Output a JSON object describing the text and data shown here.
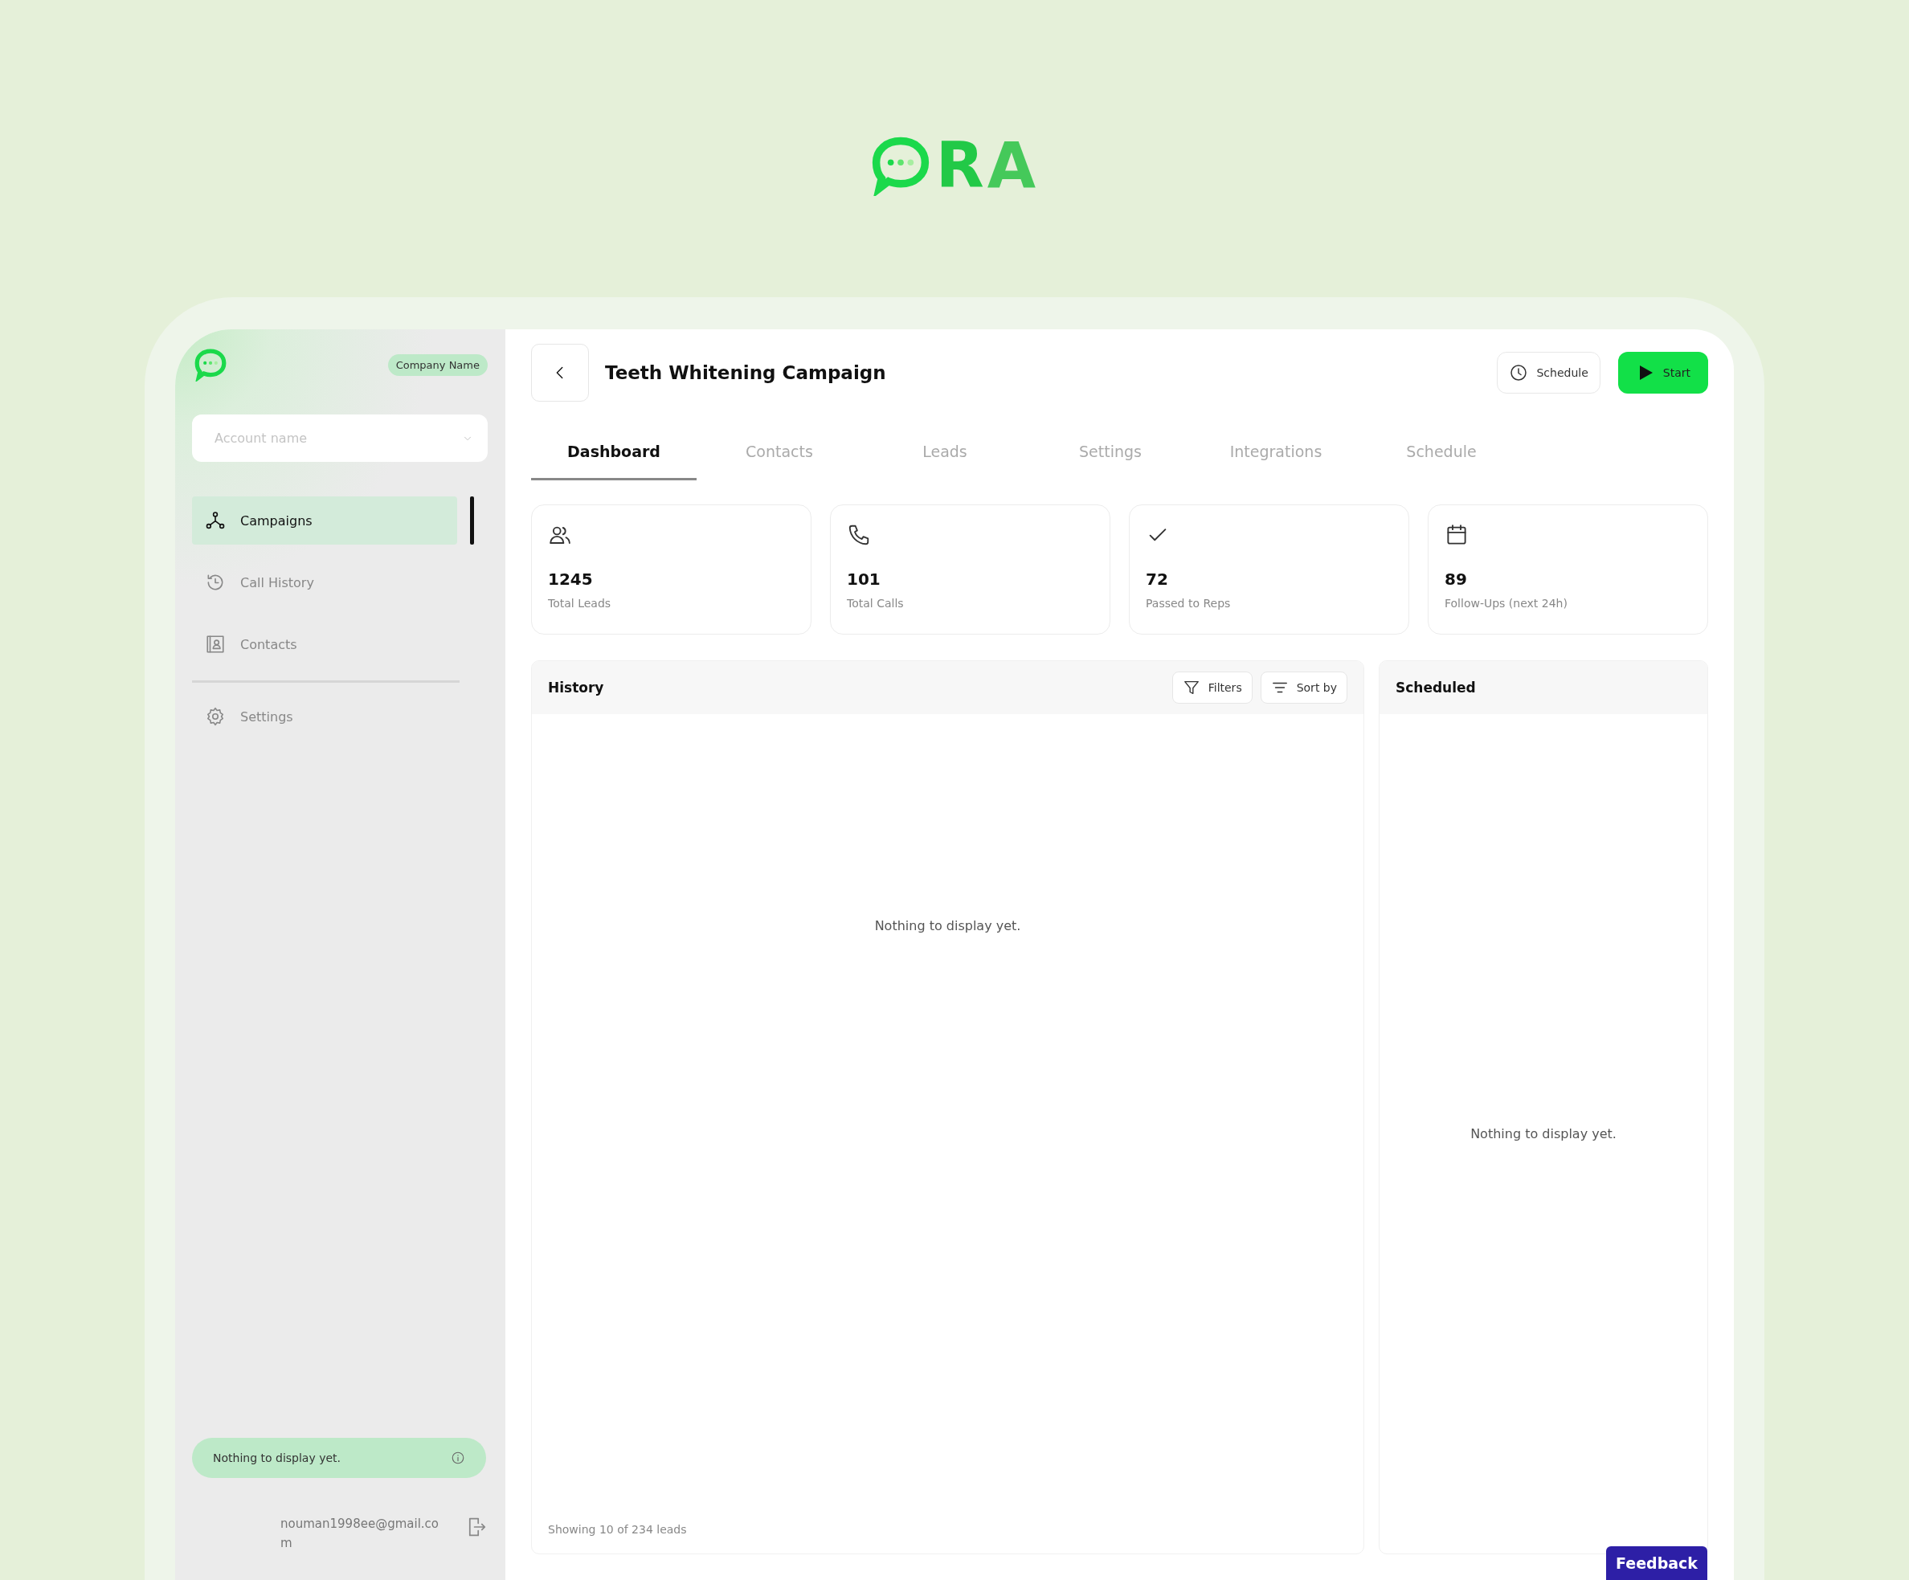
{
  "logo": {
    "text": "RA"
  },
  "sidebar": {
    "company_badge": "Company Name",
    "account_select": {
      "placeholder": "Account name"
    },
    "nav": [
      {
        "label": "Campaigns",
        "kind": "network",
        "selected": true
      },
      {
        "label": "Call History",
        "kind": "history",
        "selected": false
      },
      {
        "label": "Contacts",
        "kind": "contacts",
        "selected": false
      }
    ],
    "nav_secondary": [
      {
        "label": "Settings",
        "kind": "gear",
        "selected": false
      }
    ],
    "notice": "Nothing to display yet.",
    "email": "nouman1998ee@gmail.com"
  },
  "header": {
    "title": "Teeth Whitening Campaign",
    "buttons": [
      {
        "kind": "schedule",
        "label": "Schedule"
      },
      {
        "kind": "start",
        "label": "Start"
      }
    ]
  },
  "tabs": [
    {
      "label": "Dashboard",
      "selected": true
    },
    {
      "label": "Contacts",
      "selected": false
    },
    {
      "label": "Leads",
      "selected": false
    },
    {
      "label": "Settings",
      "selected": false
    },
    {
      "label": "Integrations",
      "selected": false
    },
    {
      "label": "Schedule",
      "selected": false
    }
  ],
  "stats": [
    {
      "kind": "users",
      "value": "1245",
      "label": "Total Leads"
    },
    {
      "kind": "phone",
      "value": "101",
      "label": "Total Calls"
    },
    {
      "kind": "check",
      "value": "72",
      "label": "Passed to Reps"
    },
    {
      "kind": "calendar",
      "value": "89",
      "label": "Follow-Ups (next 24h)"
    }
  ],
  "history": {
    "title": "History",
    "filters": "Filters",
    "sort": "Sort by",
    "empty": "Nothing to display yet.",
    "footer": "Showing 10 of 234 leads"
  },
  "scheduled": {
    "title": "Scheduled",
    "empty": "Nothing to display yet."
  },
  "feedback": "Feedback"
}
